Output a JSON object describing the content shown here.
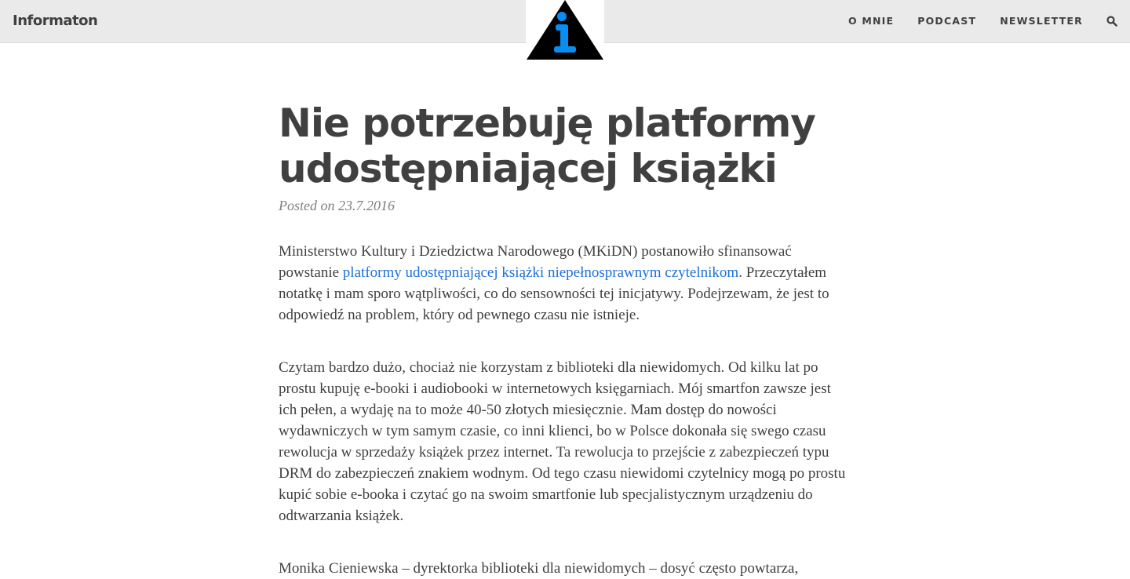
{
  "nav": {
    "brand": "Informaton",
    "items": [
      "O MNIE",
      "PODCAST",
      "NEWSLETTER"
    ]
  },
  "post": {
    "title": "Nie potrzebuję platformy udostępniającej książki",
    "meta": "Posted on 23.7.2016",
    "p1_before": "Ministerstwo Kultury i Dziedzictwa Narodowego (MKiDN) postanowiło sfinansować powstanie ",
    "p1_link": "platformy udostępniającej książki niepełnosprawnym czytelnikom",
    "p1_after": ". Przeczytałem notatkę i mam sporo wątpliwości, co do sensowności tej inicjatywy. Podejrzewam, że jest to odpowiedź na problem, który od pewnego czasu nie istnieje.",
    "p2": "Czytam bardzo dużo, chociaż nie korzystam z biblioteki dla niewidomych. Od kilku lat po prostu kupuję e-booki i audiobooki w internetowych księgarniach. Mój smartfon zawsze jest ich pełen, a wydaję na to może 40-50 złotych miesięcznie. Mam dostęp do nowości wydawniczych w tym samym czasie, co inni klienci, bo w Polsce dokonała się swego czasu rewolucja w sprzedaży książek przez internet. Ta rewolucja to przejście z zabezpieczeń typu DRM do zabezpieczeń znakiem wodnym. Od tego czasu niewidomi czytelnicy mogą po prostu kupić sobie e-booka i czytać go na swoim smartfonie lub specjalistycznym urządzeniu do odtwarzania książek.",
    "p3": "Monika Cieniewska – dyrektorka biblioteki dla niewidomych – dosyć często powtarza,"
  }
}
